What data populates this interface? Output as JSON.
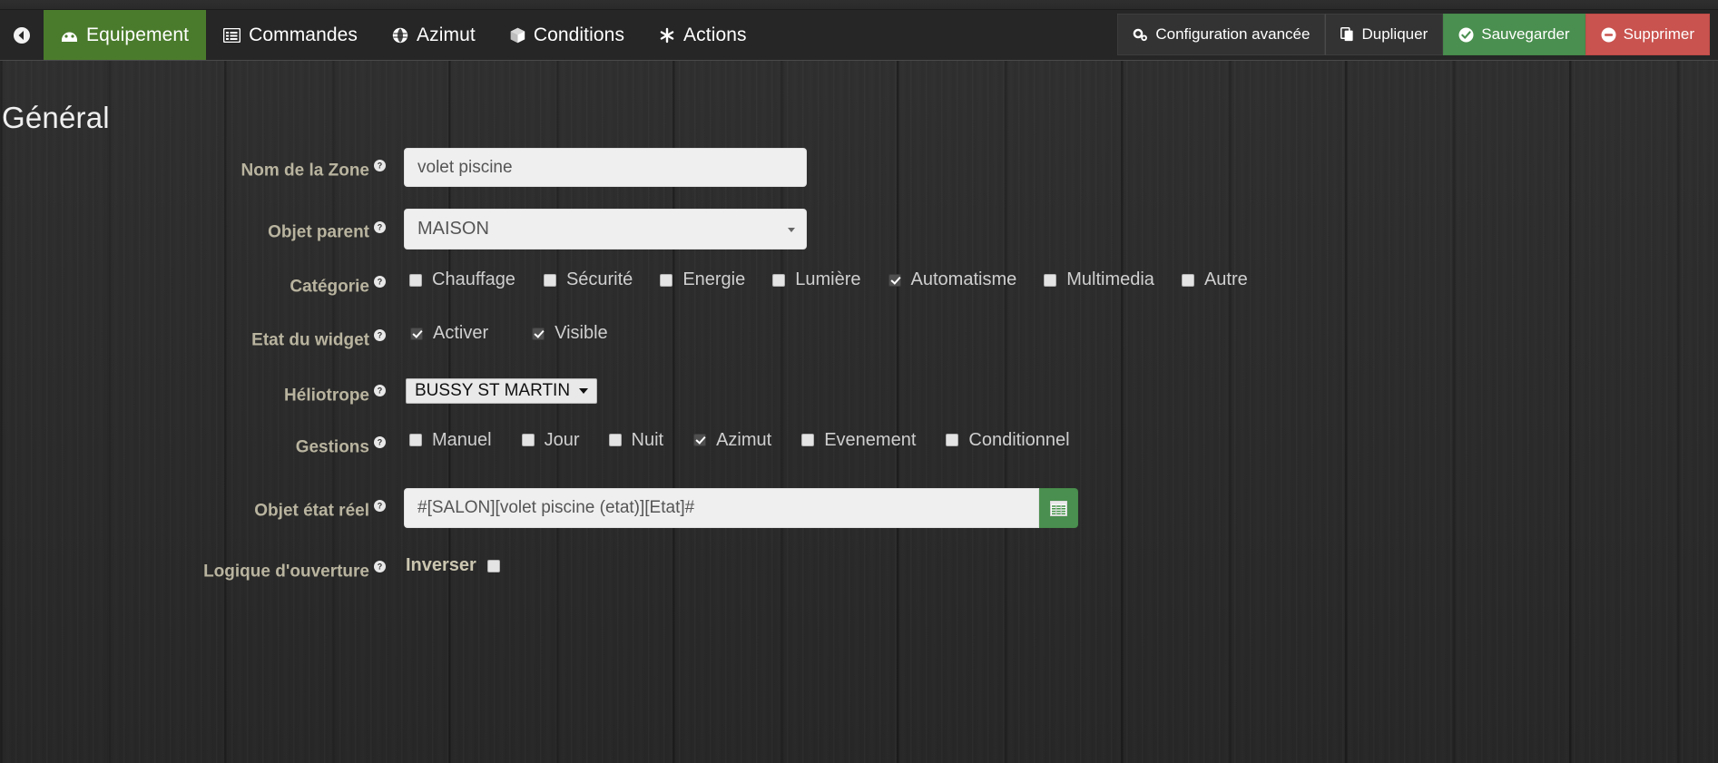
{
  "navbar": {
    "back_icon": "arrow-circle-left-icon",
    "tabs": [
      {
        "label": "Equipement",
        "icon": "dashboard-icon",
        "active": true
      },
      {
        "label": "Commandes",
        "icon": "list-alt-icon",
        "active": false
      },
      {
        "label": "Azimut",
        "icon": "globe-icon",
        "active": false
      },
      {
        "label": "Conditions",
        "icon": "cube-icon",
        "active": false
      },
      {
        "label": "Actions",
        "icon": "asterisk-icon",
        "active": false
      }
    ],
    "actions": [
      {
        "label": "Configuration avancée",
        "icon": "gears-icon",
        "style": "default"
      },
      {
        "label": "Dupliquer",
        "icon": "copy-icon",
        "style": "default"
      },
      {
        "label": "Sauvegarder",
        "icon": "check-circle-icon",
        "style": "success"
      },
      {
        "label": "Supprimer",
        "icon": "minus-circle-icon",
        "style": "danger"
      }
    ]
  },
  "page": {
    "title": "Général"
  },
  "form": {
    "nom_zone": {
      "label": "Nom de la Zone",
      "value": "volet piscine",
      "placeholder": ""
    },
    "objet_parent": {
      "label": "Objet parent",
      "value": "MAISON",
      "options": [
        "MAISON"
      ]
    },
    "categorie": {
      "label": "Catégorie",
      "items": [
        {
          "label": "Chauffage",
          "checked": false
        },
        {
          "label": "Sécurité",
          "checked": false
        },
        {
          "label": "Energie",
          "checked": false
        },
        {
          "label": "Lumière",
          "checked": false
        },
        {
          "label": "Automatisme",
          "checked": true
        },
        {
          "label": "Multimedia",
          "checked": false
        },
        {
          "label": "Autre",
          "checked": false
        }
      ]
    },
    "etat_widget": {
      "label": "Etat du widget",
      "items": [
        {
          "label": "Activer",
          "checked": true
        },
        {
          "label": "Visible",
          "checked": true
        }
      ]
    },
    "heliotrope": {
      "label": "Héliotrope",
      "value": "BUSSY ST MARTIN",
      "options": [
        "BUSSY ST MARTIN"
      ]
    },
    "gestions": {
      "label": "Gestions",
      "items": [
        {
          "label": "Manuel",
          "checked": false
        },
        {
          "label": "Jour",
          "checked": false
        },
        {
          "label": "Nuit",
          "checked": false
        },
        {
          "label": "Azimut",
          "checked": true
        },
        {
          "label": "Evenement",
          "checked": false
        },
        {
          "label": "Conditionnel",
          "checked": false
        }
      ]
    },
    "objet_etat_reel": {
      "label": "Objet état réel",
      "value": "#[SALON][volet piscine (etat)][Etat]#",
      "button_icon": "list-table-icon"
    },
    "logique_ouverture": {
      "label": "Logique d'ouverture",
      "inverser_label": "Inverser",
      "inverser_checked": false
    }
  },
  "colors": {
    "accent_green": "#4a7b2c",
    "success": "#4a8f4f",
    "danger": "#c9534f",
    "label_text": "#b9b49f",
    "page_bg": "#2b2b2b"
  }
}
